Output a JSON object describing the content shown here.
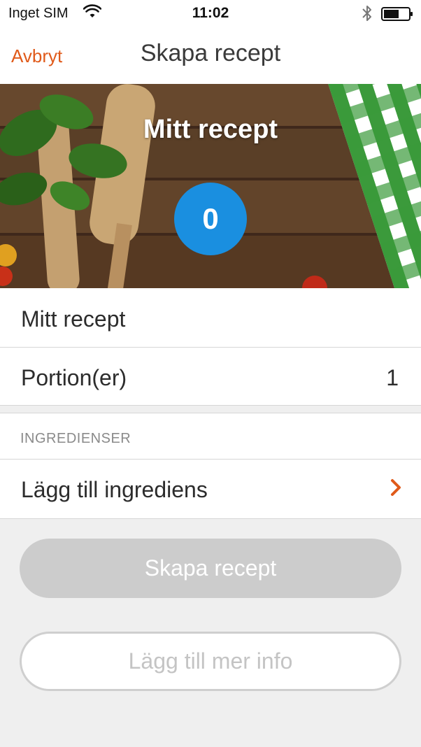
{
  "status": {
    "carrier": "Inget SIM",
    "time": "11:02",
    "wifi_icon": "wifi-icon",
    "bluetooth_icon": "bluetooth-icon",
    "battery_icon": "battery-icon"
  },
  "nav": {
    "cancel_label": "Avbryt",
    "title": "Skapa recept"
  },
  "hero": {
    "title": "Mitt recept",
    "count": "0"
  },
  "form": {
    "name_value": "Mitt recept",
    "portions_label": "Portion(er)",
    "portions_value": "1"
  },
  "ingredients": {
    "section_header": "INGREDIENSER",
    "add_label": "Lägg till ingrediens",
    "chevron_icon": "chevron-right-icon"
  },
  "actions": {
    "create_label": "Skapa recept",
    "more_info_label": "Lägg till mer info"
  },
  "colors": {
    "accent": "#e05a1a",
    "counter": "#1a8fe0",
    "disabled_button": "#cccccc",
    "background": "#efefef"
  }
}
